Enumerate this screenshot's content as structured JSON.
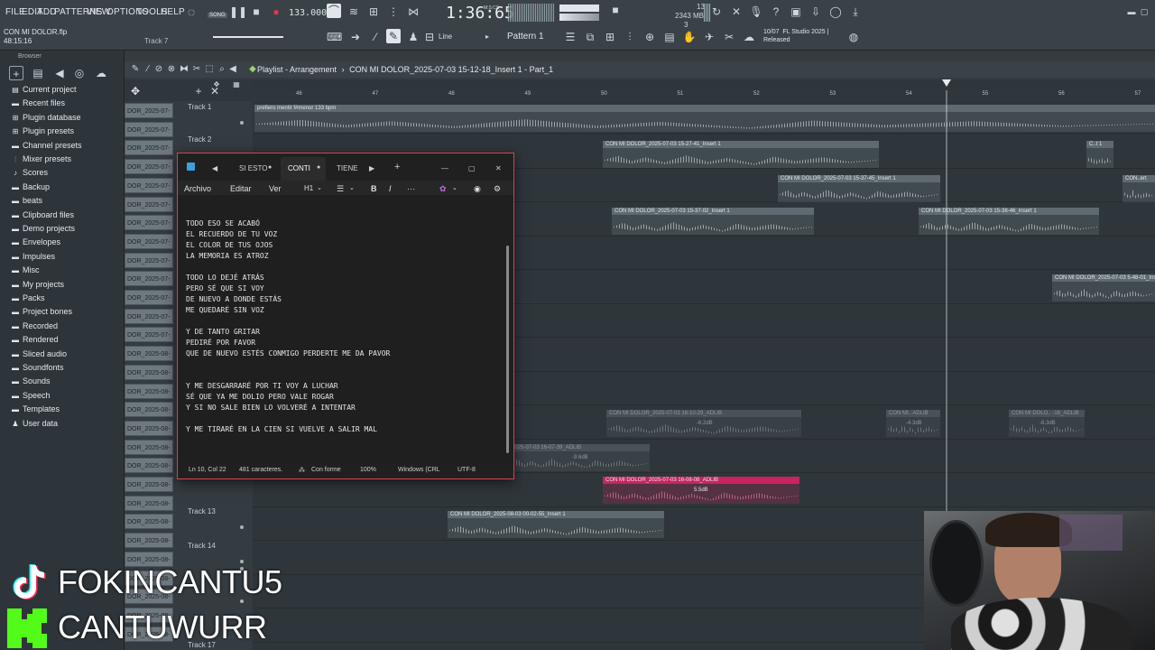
{
  "menu": [
    "FILE",
    "EDIT",
    "ADD",
    "PATTERNS",
    "VIEW",
    "OPTIONS",
    "TOOLS",
    "HELP"
  ],
  "transport": {
    "song_label": "SONG",
    "tempo": "133.000",
    "time": "1:36:65",
    "time_unit": "M:S:CS",
    "cpu": "13",
    "memory": "2343 MB",
    "voices": "3"
  },
  "project": {
    "filename": "CON MI DOLOR.flp",
    "duration": "48:15:16",
    "track_hint": "Track 7"
  },
  "toolbar": {
    "line_label": "Line",
    "pattern_label": "Pattern 1"
  },
  "news": {
    "date": "10/07",
    "text": "FL Studio 2025 |",
    "status": "Released"
  },
  "browser": {
    "header": "Browser",
    "items": [
      {
        "label": "Current project",
        "icon": "project-icon"
      },
      {
        "label": "Recent files",
        "icon": "folder-icon"
      },
      {
        "label": "Plugin database",
        "icon": "plugin-icon"
      },
      {
        "label": "Plugin presets",
        "icon": "plugin-icon"
      },
      {
        "label": "Channel presets",
        "icon": "folder-icon"
      },
      {
        "label": "Mixer presets",
        "icon": "mixer-icon"
      },
      {
        "label": "Scores",
        "icon": "scores-icon"
      },
      {
        "label": "Backup",
        "icon": "folder-icon"
      },
      {
        "label": "beats",
        "icon": "folder-icon"
      },
      {
        "label": "Clipboard files",
        "icon": "folder-icon"
      },
      {
        "label": "Demo projects",
        "icon": "folder-icon"
      },
      {
        "label": "Envelopes",
        "icon": "folder-icon"
      },
      {
        "label": "Impulses",
        "icon": "folder-icon"
      },
      {
        "label": "Misc",
        "icon": "folder-icon"
      },
      {
        "label": "My projects",
        "icon": "folder-icon"
      },
      {
        "label": "Packs",
        "icon": "folder-icon"
      },
      {
        "label": "Project bones",
        "icon": "folder-icon"
      },
      {
        "label": "Recorded",
        "icon": "folder-icon"
      },
      {
        "label": "Rendered",
        "icon": "folder-icon"
      },
      {
        "label": "Sliced audio",
        "icon": "folder-icon"
      },
      {
        "label": "Soundfonts",
        "icon": "folder-icon"
      },
      {
        "label": "Sounds",
        "icon": "folder-icon"
      },
      {
        "label": "Speech",
        "icon": "folder-icon"
      },
      {
        "label": "Templates",
        "icon": "folder-icon"
      },
      {
        "label": "User data",
        "icon": "user-icon"
      }
    ]
  },
  "playlist": {
    "title": "Playlist - Arrangement",
    "breadcrumb": "CON MI DOLOR_2025-07-03 15-12-18_Insert 1 - Part_1",
    "ruler": [
      "46",
      "47",
      "48",
      "49",
      "50",
      "51",
      "52",
      "53",
      "54",
      "55",
      "56",
      "57"
    ],
    "clip_names": [
      "DOR_2025-07-",
      "DOR_2025-07-",
      "DOR_2025-07-",
      "DOR_2025-07-",
      "DOR_2025-07-",
      "DOR_2025-07-",
      "DOR_2025-07-",
      "DOR_2025-07-",
      "DOR_2025-07-",
      "DOR_2025-07-",
      "DOR_2025-07-",
      "DOR_2025-07-",
      "DOR_2025-07-",
      "DOR_2025-08-",
      "DOR_2025-08-",
      "DOR_2025-08-",
      "DOR_2025-08-",
      "DOR_2025-08-",
      "DOR_2025-08-",
      "DOR_2025-08-",
      "DOR_2025-08-",
      "DOR_2025-08-",
      "DOR_2025-08-",
      "DOR_2025-08-",
      "DOR_2025-08-",
      "DOR_2025-08-",
      "DOR_2025-08-",
      "DOR_2025-08-",
      "DOR_2025-08-"
    ],
    "tracks": [
      "Track 1",
      "Track 2",
      "Track 13",
      "Track 14",
      "Track 17"
    ],
    "clips": [
      {
        "label": "prefiero mentir f#menor 133 bpm"
      },
      {
        "label": "CON MI DOLOR_2025-07-03 15-27-41_Insert 1"
      },
      {
        "label": "C..t 1"
      },
      {
        "label": "CON MI DOLOR_2025-07-03 15-37-45_Insert 1"
      },
      {
        "label": "CON..ert"
      },
      {
        "label": "CON MI DOLOR_2025-07-03 15-37-02_Insert 1"
      },
      {
        "label": "CON MI DOLOR_2025-07-03 15-38-46_Insert 1"
      },
      {
        "label": "CON MI DOLOR_2025-07-03 5-48-01_Inse"
      },
      {
        "label": "CON MI DOLOR_2025-07-03 16-10-29_ADLIB",
        "db": "-6.2dB"
      },
      {
        "label": "CON MI.. ADLIB",
        "db": "-4.3dB"
      },
      {
        "label": "CON MI DOLO.. -16_ADLIB",
        "db": "-8.3dB"
      },
      {
        "label": "2025-07-03 16-07-39_ADLIB",
        "db": "-9.6dB"
      },
      {
        "label": "CON MI DOLOR_2025-07-03 16-08-08_ADLIB",
        "db": "5.5dB"
      },
      {
        "label": "CON MI DOLOR_2025-08-03 00-02-55_Insert 1"
      }
    ]
  },
  "notepad": {
    "tabs": [
      "SI ESTO",
      "CONTI",
      "TIENE"
    ],
    "menu": [
      "Archivo",
      "Editar",
      "Ver"
    ],
    "heading_label": "H1",
    "lines": [
      "TODO ESO SE ACABÓ",
      "EL RECUERDO DE TU VOZ",
      "EL COLOR DE TUS OJOS",
      "LA MEMORIA ES ATROZ",
      "",
      "TODO LO DEJÉ ATRÁS",
      "PERO SÉ QUE SI VOY",
      "DE NUEVO A DONDE ESTÁS",
      "ME QUEDARÉ SIN VOZ",
      "",
      "Y DE TANTO GRITAR",
      "PEDIRÉ POR FAVOR",
      "QUE DE NUEVO ESTÉS CONMIGO PERDERTE ME DA PAVOR",
      "",
      "",
      "Y ME DESGARRARÉ POR TI VOY A LUCHAR",
      "SÉ QUE YA ME DOLIO PERO VALE ROGAR",
      "Y SI NO SALE BIEN LO VOLVERÉ A INTENTAR",
      "",
      "Y ME TIRARÉ EN LA CIEN SI VUELVE A SALIR MAL"
    ],
    "status": {
      "position": "Ln 10, Col 22",
      "chars": "481 caracteres.",
      "format": "Con forme",
      "zoom": "100%",
      "line_ending": "Windows (CRL",
      "encoding": "UTF-8"
    }
  },
  "overlay": {
    "tiktok_handle": "FOKINCANTU5",
    "kick_handle": "CANTUWURR",
    "colors": {
      "kick": "#53fc18",
      "tiktok_red": "#fe2c55",
      "tiktok_cyan": "#25f4ee"
    }
  }
}
